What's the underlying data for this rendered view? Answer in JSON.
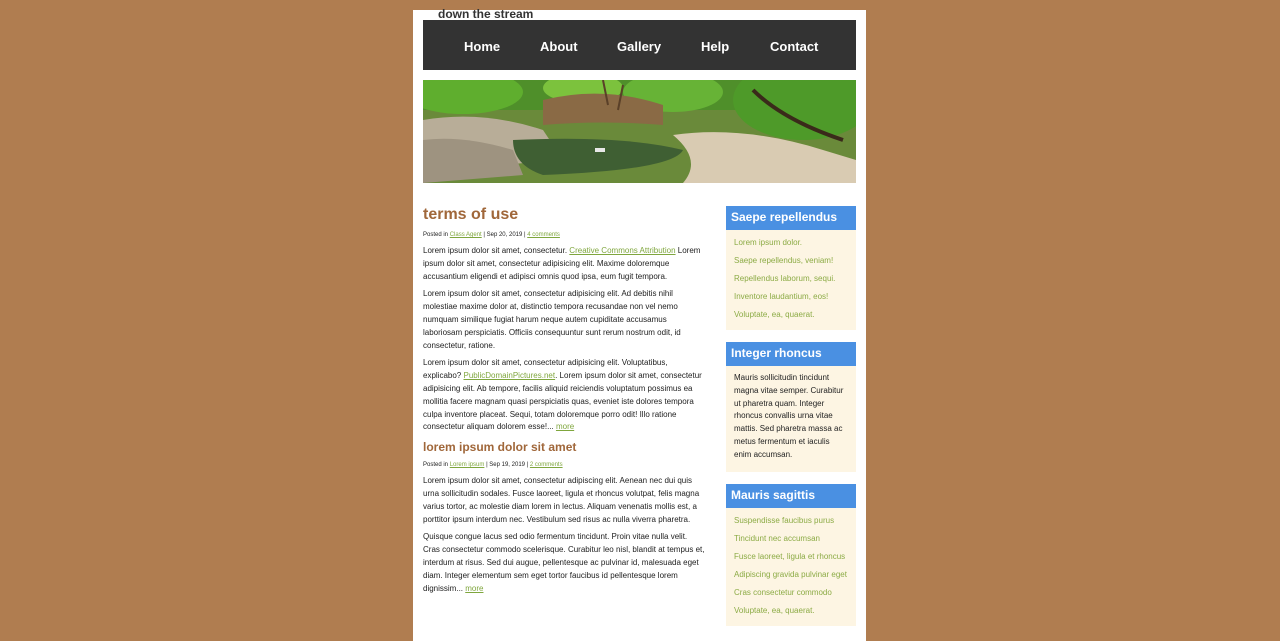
{
  "site": {
    "title": "down the stream"
  },
  "nav": [
    "Home",
    "About",
    "Gallery",
    "Help",
    "Contact"
  ],
  "posts": [
    {
      "title": "terms of use",
      "meta_prefix": "Posted in",
      "category": "Class Agent",
      "date": "| Sep 20, 2019 |",
      "comments": "4 comments",
      "paragraphs": [
        {
          "a": "Lorem ipsum dolor sit amet, consectetur. ",
          "link": "Creative Commons Attribution",
          "b": " Lorem ipsum dolor sit amet, consectetur adipisicing elit. Maxime doloremque accusantium eligendi et adipisci omnis quod ipsa, eum fugit tempora."
        },
        {
          "a": "Lorem ipsum dolor sit amet, consectetur adipisicing elit. Ad debitis nihil molestiae maxime dolor at, distinctio tempora recusandae non vel nemo numquam similique fugiat harum neque autem cupiditate accusamus laboriosam perspiciatis. Officiis consequuntur sunt rerum nostrum odit, id consectetur, ratione."
        },
        {
          "a": "Lorem ipsum dolor sit amet, consectetur adipisicing elit. Voluptatibus, explicabo? ",
          "link": "PublicDomainPictures.net",
          "b": ". Lorem ipsum dolor sit amet, consectetur adipisicing elit. Ab tempore, facilis aliquid reiciendis voluptatum possimus ea mollitia facere magnam quasi perspiciatis quas, eveniet iste dolores tempora culpa inventore placeat. Sequi, totam doloremque porro odit! Illo ratione consectetur aliquam dolorem esse!... ",
          "more": "more"
        }
      ]
    },
    {
      "title": "lorem ipsum dolor sit amet",
      "meta_prefix": "Posted in",
      "category": "Lorem ipsum",
      "date": "| Sep 19, 2019 |",
      "comments": "2 comments",
      "paragraphs": [
        {
          "a": "Lorem ipsum dolor sit amet, consectetur adipiscing elit. Aenean nec dui quis urna sollicitudin sodales. Fusce laoreet, ligula et rhoncus volutpat, felis magna varius tortor, ac molestie diam lorem in lectus. Aliquam venenatis mollis est, a porttitor ipsum interdum nec. Vestibulum sed risus ac nulla viverra pharetra."
        },
        {
          "a": "Quisque congue lacus sed odio fermentum tincidunt. Proin vitae nulla velit. Cras consectetur commodo scelerisque. Curabitur leo nisl, blandit at tempus et, interdum at risus. Sed dui augue, pellentesque ac pulvinar id, malesuada eget diam. Integer elementum sem eget tortor faucibus id pellentesque lorem dignissim... ",
          "more": "more"
        }
      ]
    }
  ],
  "sidebar": [
    {
      "title": "Saepe repellendus",
      "links": [
        "Lorem ipsum dolor.",
        "Saepe repellendus, veniam!",
        "Repellendus laborum, sequi.",
        "Inventore laudantium, eos!",
        "Voluptate, ea, quaerat."
      ]
    },
    {
      "title": "Integer rhoncus",
      "text": "Mauris sollicitudin tincidunt magna vitae semper. Curabitur ut pharetra quam. Integer rhoncus convallis urna vitae mattis. Sed pharetra massa ac metus fermentum et iaculis enim accumsan."
    },
    {
      "title": "Mauris sagittis",
      "links": [
        "Suspendisse faucibus purus",
        "Tincidunt nec accumsan",
        "Fusce laoreet, ligula et rhoncus",
        "Adipiscing gravida pulvinar eget",
        "Cras consectetur commodo",
        "Voluptate, ea, quaerat."
      ]
    }
  ],
  "colors": {
    "background": "#b07d50",
    "nav": "#333333",
    "heading": "#a0673a",
    "link": "#7fa63d",
    "sidebar_head": "#4a90e2",
    "sidebar_body": "#fdf5e3"
  }
}
